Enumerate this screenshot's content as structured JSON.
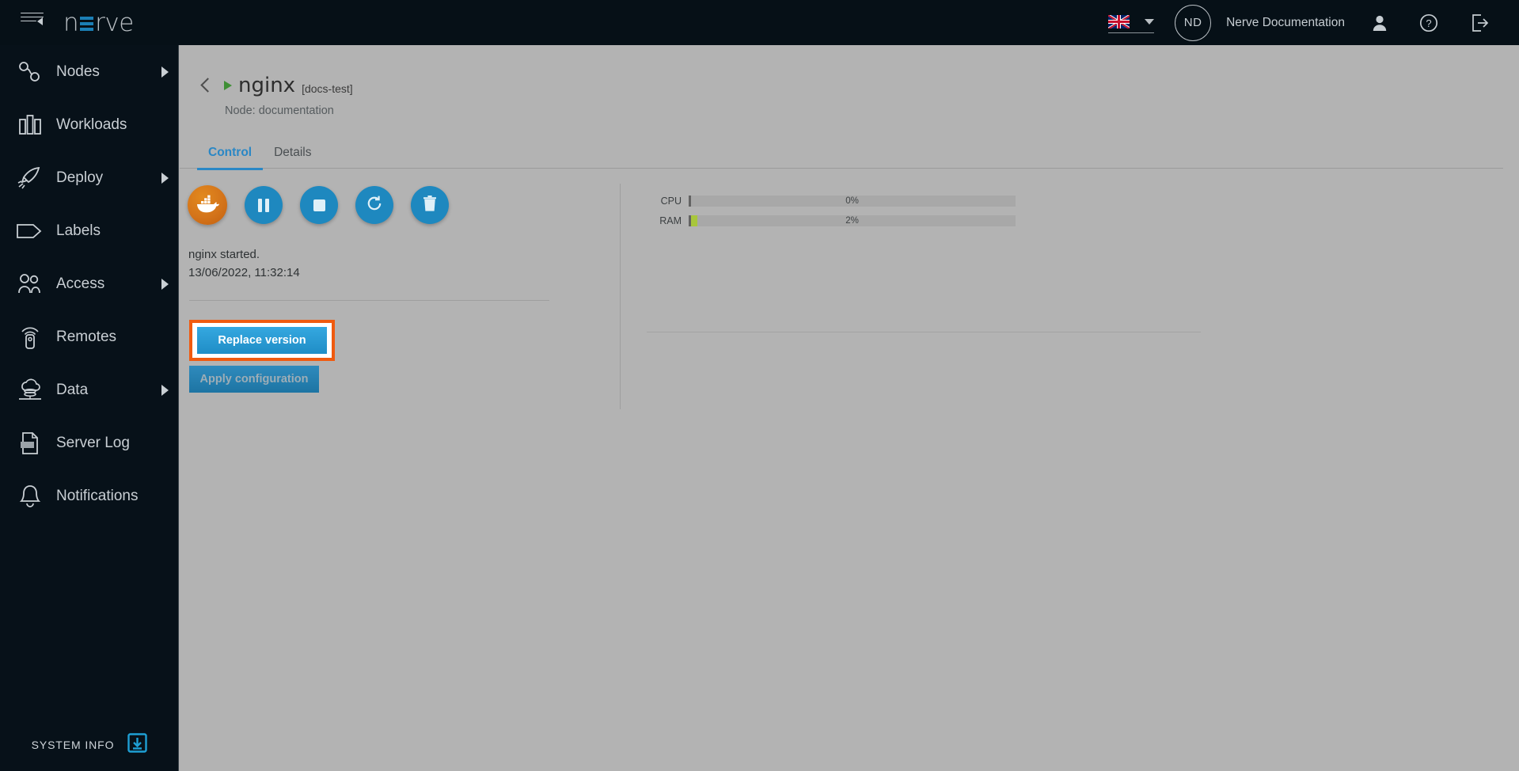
{
  "app": {
    "brand_prefix": "n",
    "brand_suffix": "rve",
    "menu_icon": "hamburger-collapse-icon"
  },
  "header": {
    "language_flag": "uk-flag-icon",
    "language_caret": "chevron-down-icon",
    "avatar_initials": "ND",
    "account_name": "Nerve Documentation",
    "user_icon": "person-icon",
    "help_icon": "question-mark-icon",
    "logout_icon": "logout-icon"
  },
  "sidebar": {
    "items": [
      {
        "label": "Nodes",
        "icon": "nodes-icon",
        "has_arrow": true
      },
      {
        "label": "Workloads",
        "icon": "workloads-bars-icon",
        "has_arrow": false
      },
      {
        "label": "Deploy",
        "icon": "rocket-icon",
        "has_arrow": true
      },
      {
        "label": "Labels",
        "icon": "tag-icon",
        "has_arrow": false
      },
      {
        "label": "Access",
        "icon": "users-icon",
        "has_arrow": true
      },
      {
        "label": "Remotes",
        "icon": "remote-control-icon",
        "has_arrow": false
      },
      {
        "label": "Data",
        "icon": "cloud-database-icon",
        "has_arrow": true
      },
      {
        "label": "Server Log",
        "icon": "log-file-icon",
        "has_arrow": false
      },
      {
        "label": "Notifications",
        "icon": "bell-icon",
        "has_arrow": false
      }
    ],
    "system_info": {
      "label": "SYSTEM INFO",
      "icon": "download-box-icon"
    }
  },
  "main": {
    "back_icon": "back-chevron-icon",
    "run_state_icon": "play-triangle-icon",
    "workload_name": "nginx",
    "workload_version": "[docs-test]",
    "node_line": "Node: documentation",
    "tabs": [
      {
        "label": "Control",
        "active": true
      },
      {
        "label": "Details",
        "active": false
      }
    ],
    "control": {
      "buttons": [
        {
          "name": "docker-logo-button",
          "icon": "docker-whale-icon"
        },
        {
          "name": "pause-button",
          "icon": "pause-icon"
        },
        {
          "name": "stop-button",
          "icon": "stop-icon"
        },
        {
          "name": "restart-button",
          "icon": "restart-icon"
        },
        {
          "name": "delete-button",
          "icon": "trash-icon"
        }
      ],
      "status_message": "nginx started.",
      "status_timestamp": "13/06/2022, 11:32:14",
      "replace_version_label": "Replace version",
      "apply_configuration_label": "Apply configuration"
    },
    "resources": [
      {
        "label": "CPU",
        "value": "0%",
        "percent": 0
      },
      {
        "label": "RAM",
        "value": "2%",
        "percent": 2
      }
    ]
  },
  "colors": {
    "sidebar_bg": "#071119",
    "header_bg": "#061017",
    "page_bg": "#b3b3b3",
    "accent_blue": "#2a87c5",
    "button_blue": "#1e88bf",
    "docker_orange": "#d4741a",
    "highlight_orange": "#f05a0f",
    "run_green": "#3f8f35",
    "ram_green": "#a8c63c"
  }
}
